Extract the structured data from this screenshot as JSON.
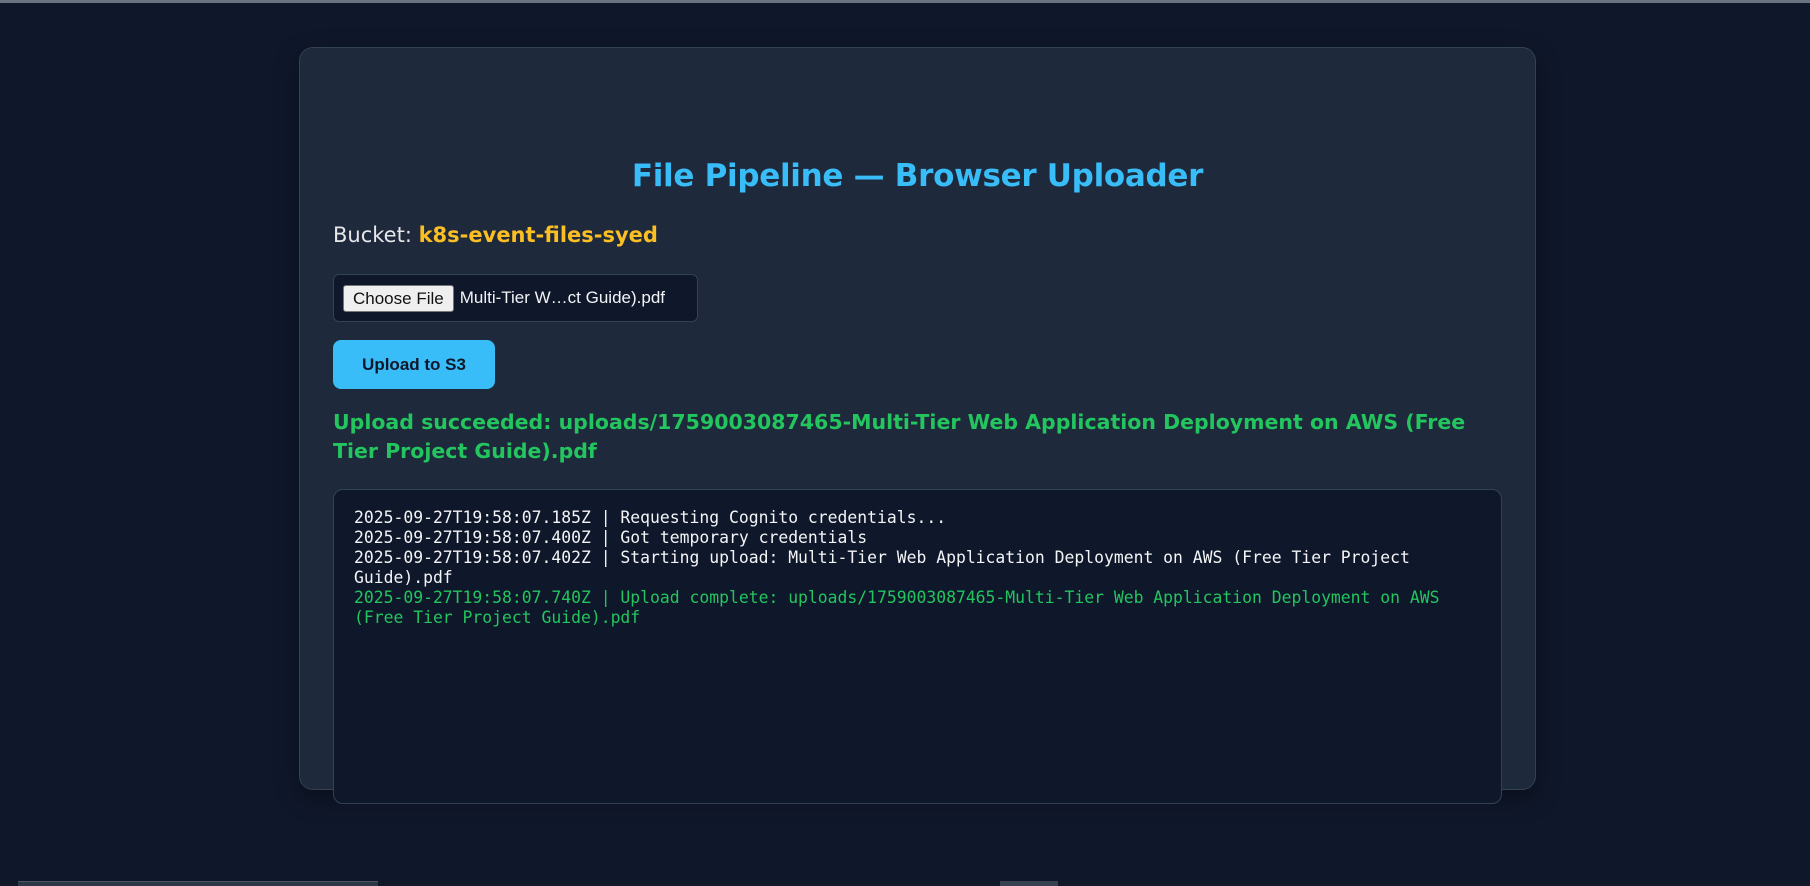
{
  "page": {
    "title": "File Pipeline — Browser Uploader"
  },
  "bucket": {
    "label": "Bucket:",
    "name": "k8s-event-files-syed"
  },
  "file_input": {
    "button_label": "Choose File",
    "selected_file": "Multi-Tier W…ct Guide).pdf"
  },
  "actions": {
    "upload_label": "Upload to S3"
  },
  "status": {
    "message": "Upload succeeded: uploads/1759003087465-Multi-Tier Web Application Deployment on AWS (Free Tier Project Guide).pdf"
  },
  "log": {
    "lines": [
      "2025-09-27T19:58:07.185Z | Requesting Cognito credentials...",
      "2025-09-27T19:58:07.400Z | Got temporary credentials",
      "2025-09-27T19:58:07.402Z | Starting upload: Multi-Tier Web Application Deployment on AWS (Free Tier Project Guide).pdf",
      "2025-09-27T19:58:07.740Z | Upload complete: uploads/1759003087465-Multi-Tier Web Application Deployment on AWS (Free Tier Project Guide).pdf"
    ]
  },
  "colors": {
    "page_background": "#0f172a",
    "card_background": "#1e293b",
    "accent": "#38bdf8",
    "bucket_highlight": "#fbbf24",
    "success": "#22c55e"
  }
}
